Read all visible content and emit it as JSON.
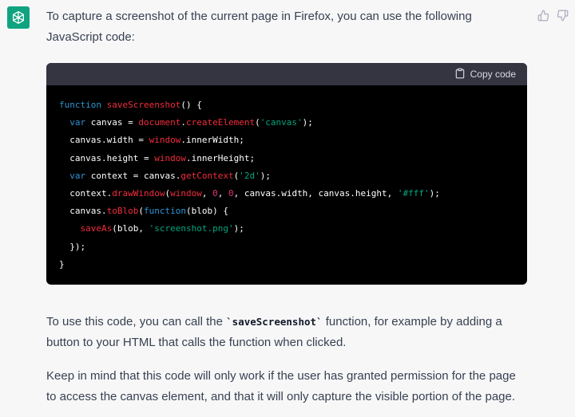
{
  "message": {
    "intro": "To capture a screenshot of the current page in Firefox, you can use the following JavaScript code:",
    "copy_label": "Copy code",
    "code": {
      "l1_kw": "function",
      "l1_fn": "saveScreenshot",
      "l1_rest": "() {",
      "l2_kw": "var",
      "l2_a": " canvas = ",
      "l2_fn1": "document",
      "l2_dot": ".",
      "l2_fn2": "createElement",
      "l2_b": "(",
      "l2_str": "'canvas'",
      "l2_c": ");",
      "l3_a": "canvas.width = ",
      "l3_fn": "window",
      "l3_b": ".innerWidth;",
      "l4_a": "canvas.height = ",
      "l4_fn": "window",
      "l4_b": ".innerHeight;",
      "l5_kw": "var",
      "l5_a": " context = canvas.",
      "l5_fn": "getContext",
      "l5_b": "(",
      "l5_str": "'2d'",
      "l5_c": ");",
      "l6_a": "context.",
      "l6_fn1": "drawWindow",
      "l6_b": "(",
      "l6_fn2": "window",
      "l6_c": ", ",
      "l6_n1": "0",
      "l6_d": ", ",
      "l6_n2": "0",
      "l6_e": ", canvas.width, canvas.height, ",
      "l6_str": "'#fff'",
      "l6_f": ");",
      "l7_a": "canvas.",
      "l7_fn": "toBlob",
      "l7_b": "(",
      "l7_kw": "function",
      "l7_c": "(blob) {",
      "l8_fn": "saveAs",
      "l8_a": "(blob, ",
      "l8_str": "'screenshot.png'",
      "l8_b": ");",
      "l9": "});",
      "l10": "}"
    },
    "p2_before": "To use this code, you can call the ",
    "p2_code": "`saveScreenshot`",
    "p2_after": " function, for example by adding a button to your HTML that calls the function when clicked.",
    "p3": "Keep in mind that this code will only work if the user has granted permission for the page to access the canvas element, and that it will only capture the visible portion of the page."
  },
  "icons": {
    "avatar": "openai-logo-icon",
    "thumbs_up": "thumbs-up-icon",
    "thumbs_down": "thumbs-down-icon",
    "copy": "clipboard-icon"
  },
  "colors": {
    "avatar_bg": "#10a37f",
    "code_bg": "#000000",
    "code_header_bg": "#343541"
  }
}
